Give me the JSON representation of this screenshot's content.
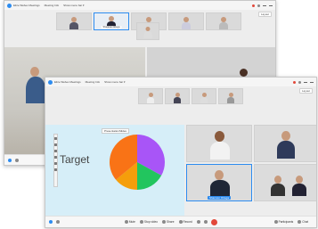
{
  "back_window": {
    "title_logo": "app-logo",
    "tabs": [
      {
        "label": "Elize Webex Meetings"
      },
      {
        "label": "Meeting Info"
      },
      {
        "label": "Show menu bar ▾"
      }
    ],
    "layout_label": "Layout",
    "thumb_name": "Shannon Ortega"
  },
  "front_window": {
    "tabs": [
      {
        "label": "Elize Webex Meetings"
      },
      {
        "label": "Meeting Info"
      },
      {
        "label": "Show menu bar ▾"
      }
    ],
    "layout_label": "Layout",
    "share_label": "PresentationSlides",
    "share_big_text": "Target",
    "active_video_name": "Shannon Ortega",
    "controls": [
      {
        "label": "Mute"
      },
      {
        "label": "Stop video"
      },
      {
        "label": "Share"
      },
      {
        "label": "Record"
      },
      {
        "label": "Participants"
      },
      {
        "label": "Chat"
      }
    ],
    "pie": {
      "values": [
        33,
        17,
        14,
        36
      ],
      "colors": [
        "#a855f7",
        "#22c55e",
        "#f59e0b",
        "#f97316"
      ]
    }
  },
  "colors": {
    "accent": "#2d8cf0",
    "end_call": "#e2483a",
    "share_bg": "#d6eef8"
  }
}
